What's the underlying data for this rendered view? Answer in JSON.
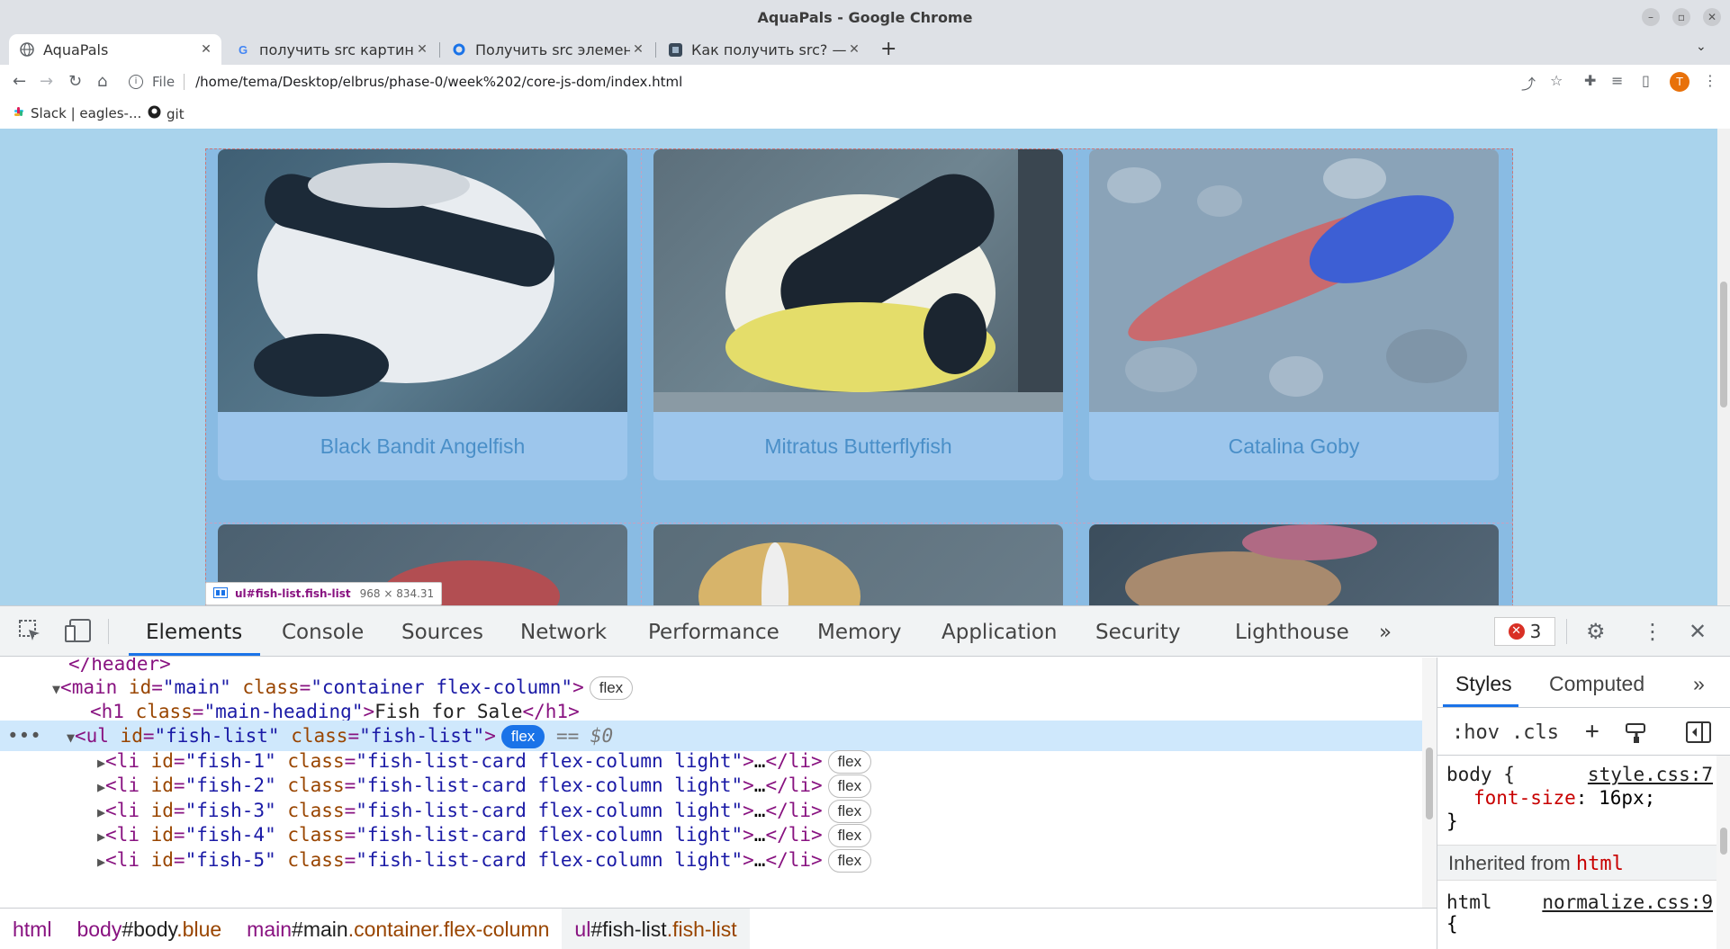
{
  "window": {
    "title": "AquaPals - Google Chrome"
  },
  "tabs": [
    {
      "label": "AquaPals",
      "icon": "globe-icon"
    },
    {
      "label": "получить src картинки js",
      "icon": "google-icon"
    },
    {
      "label": "Получить src элемента in",
      "icon": "site-icon"
    },
    {
      "label": "Как получить src? — Хабр",
      "icon": "habr-icon"
    }
  ],
  "toolbar": {
    "scheme": "File",
    "url": "/home/tema/Desktop/elbrus/phase-0/week%202/core-js-dom/index.html",
    "profile_initial": "T"
  },
  "bookmarks": [
    {
      "label": "Slack | eagles-...",
      "icon": "slack-icon"
    },
    {
      "label": "git",
      "icon": "github-icon"
    }
  ],
  "page": {
    "cards": [
      {
        "name": "Black Bandit Angelfish"
      },
      {
        "name": "Mitratus Butterflyfish"
      },
      {
        "name": "Catalina Goby"
      }
    ],
    "tooltip": {
      "selector": "ul#fish-list.fish-list",
      "size": "968 × 834.31"
    }
  },
  "devtools": {
    "tabs": [
      "Elements",
      "Console",
      "Sources",
      "Network",
      "Performance",
      "Memory",
      "Application",
      "Security",
      "Lighthouse"
    ],
    "more": "»",
    "error_count": "3",
    "dom": {
      "header_close": "</header>",
      "main_open_tag": "main",
      "main_id_attr": "id",
      "main_id_val": "\"main\"",
      "main_class_attr": "class",
      "main_class_val": "\"container flex-column\"",
      "h1_text": "Fish for Sale",
      "ul_id_val": "\"fish-list\"",
      "ul_class_val": "\"fish-list\"",
      "eq0": "== $0",
      "flex": "flex",
      "li_items": [
        {
          "id": "\"fish-1\"",
          "cls": "\"fish-list-card flex-column light\""
        },
        {
          "id": "\"fish-2\"",
          "cls": "\"fish-list-card flex-column light\""
        },
        {
          "id": "\"fish-3\"",
          "cls": "\"fish-list-card flex-column light\""
        },
        {
          "id": "\"fish-4\"",
          "cls": "\"fish-list-card flex-column light\""
        },
        {
          "id": "\"fish-5\"",
          "cls": "\"fish-list-card flex-column light\""
        }
      ]
    },
    "breadcrumbs": [
      {
        "tag": "html",
        "id": "",
        "cls": ""
      },
      {
        "tag": "body",
        "id": "#body",
        "cls": ".blue"
      },
      {
        "tag": "main",
        "id": "#main",
        "cls": ".container.flex-column"
      },
      {
        "tag": "ul",
        "id": "#fish-list",
        "cls": ".fish-list"
      }
    ],
    "styles": {
      "tabs": [
        "Styles",
        "Computed"
      ],
      "more": "»",
      "hov": ":hov",
      "cls": ".cls",
      "rule1": {
        "selector": "body {",
        "source": "style.css:7",
        "prop": "font-size",
        "value": "16px;",
        "close": "}"
      },
      "inherited_label": "Inherited from",
      "inherited_tag": "html",
      "rule2": {
        "selector": "html",
        "source": "normalize.css:9",
        "open": "{"
      }
    }
  }
}
